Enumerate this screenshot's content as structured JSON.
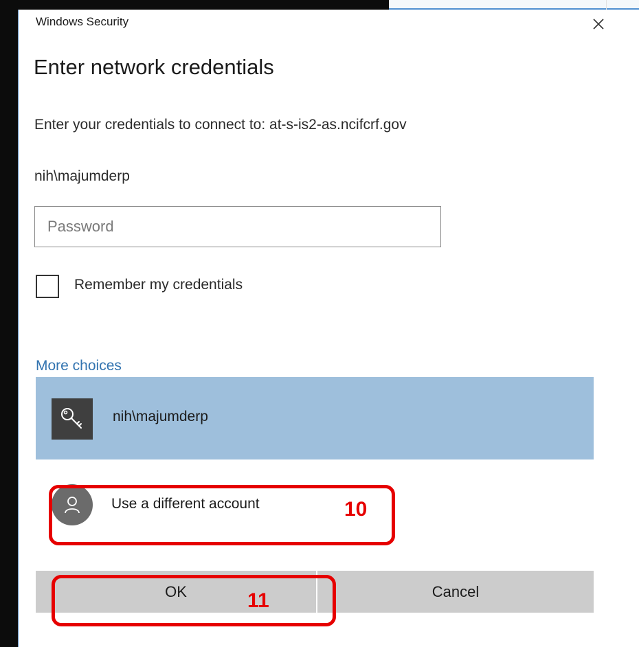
{
  "window": {
    "title": "Windows Security",
    "close_icon": "close-icon"
  },
  "dialog": {
    "heading": "Enter network credentials",
    "subtext": "Enter your credentials to connect to: at-s-is2-as.ncifcrf.gov",
    "username": "nih\\majumderp",
    "password_placeholder": "Password",
    "password_value": "",
    "remember_label": "Remember my credentials",
    "remember_checked": false,
    "more_choices": "More choices"
  },
  "accounts": {
    "selected": {
      "label": "nih\\majumderp",
      "icon": "key-icon"
    },
    "different": {
      "label": "Use a different account",
      "icon": "user-icon"
    }
  },
  "buttons": {
    "ok": "OK",
    "cancel": "Cancel"
  },
  "annotations": {
    "different_account_step": "10",
    "ok_step": "11"
  },
  "colors": {
    "link": "#3374b0",
    "selected_account_bg": "#9ebfdc",
    "button_bg": "#cccccc",
    "annotation_red": "#e60000"
  }
}
